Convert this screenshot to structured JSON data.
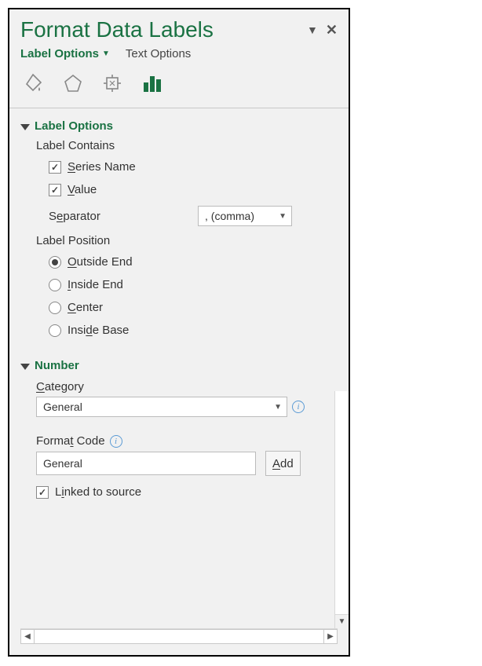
{
  "title": "Format Data Labels",
  "tabs": {
    "label_options": "Label Options",
    "text_options": "Text Options"
  },
  "section_label_options": "Label Options",
  "label_contains": "Label Contains",
  "checks": {
    "series_name": "Series Name",
    "value": "Value"
  },
  "separator": {
    "label": "Separator",
    "value": ", (comma)"
  },
  "label_position": "Label Position",
  "positions": {
    "outside_end": "Outside End",
    "inside_end": "Inside End",
    "center": "Center",
    "inside_base": "Inside Base"
  },
  "section_number": "Number",
  "category": {
    "label": "Category",
    "value": "General"
  },
  "format_code": {
    "label": "Format Code",
    "value": "General",
    "add": "Add"
  },
  "linked": "Linked to source"
}
